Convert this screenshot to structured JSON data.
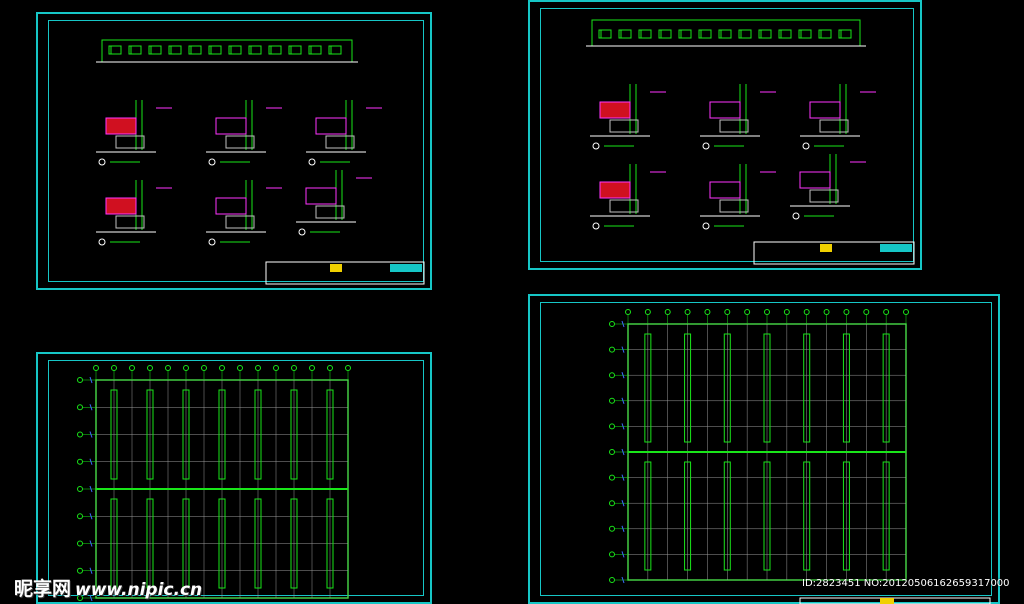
{
  "watermark": {
    "brand": "昵享网",
    "url": "www.nipic.cn"
  },
  "image_id": "ID:2823451 NO:20120506162659317000",
  "colors": {
    "background": "#000000",
    "frame": "#16c6c6",
    "lines": "#19e619",
    "annotation": "#ff33ff",
    "dimension": "#ffffff",
    "fill_red": "#d01020",
    "hatch": "#c0c0c0",
    "accent_yellow": "#f0d000"
  },
  "sheets": [
    {
      "id": "detail-sheet-left",
      "kind": "details"
    },
    {
      "id": "detail-sheet-right",
      "kind": "details"
    },
    {
      "id": "plan-sheet-left",
      "kind": "plan",
      "cols": 7,
      "rows": 8
    },
    {
      "id": "plan-sheet-right",
      "kind": "plan",
      "cols": 7,
      "rows": 10
    }
  ]
}
